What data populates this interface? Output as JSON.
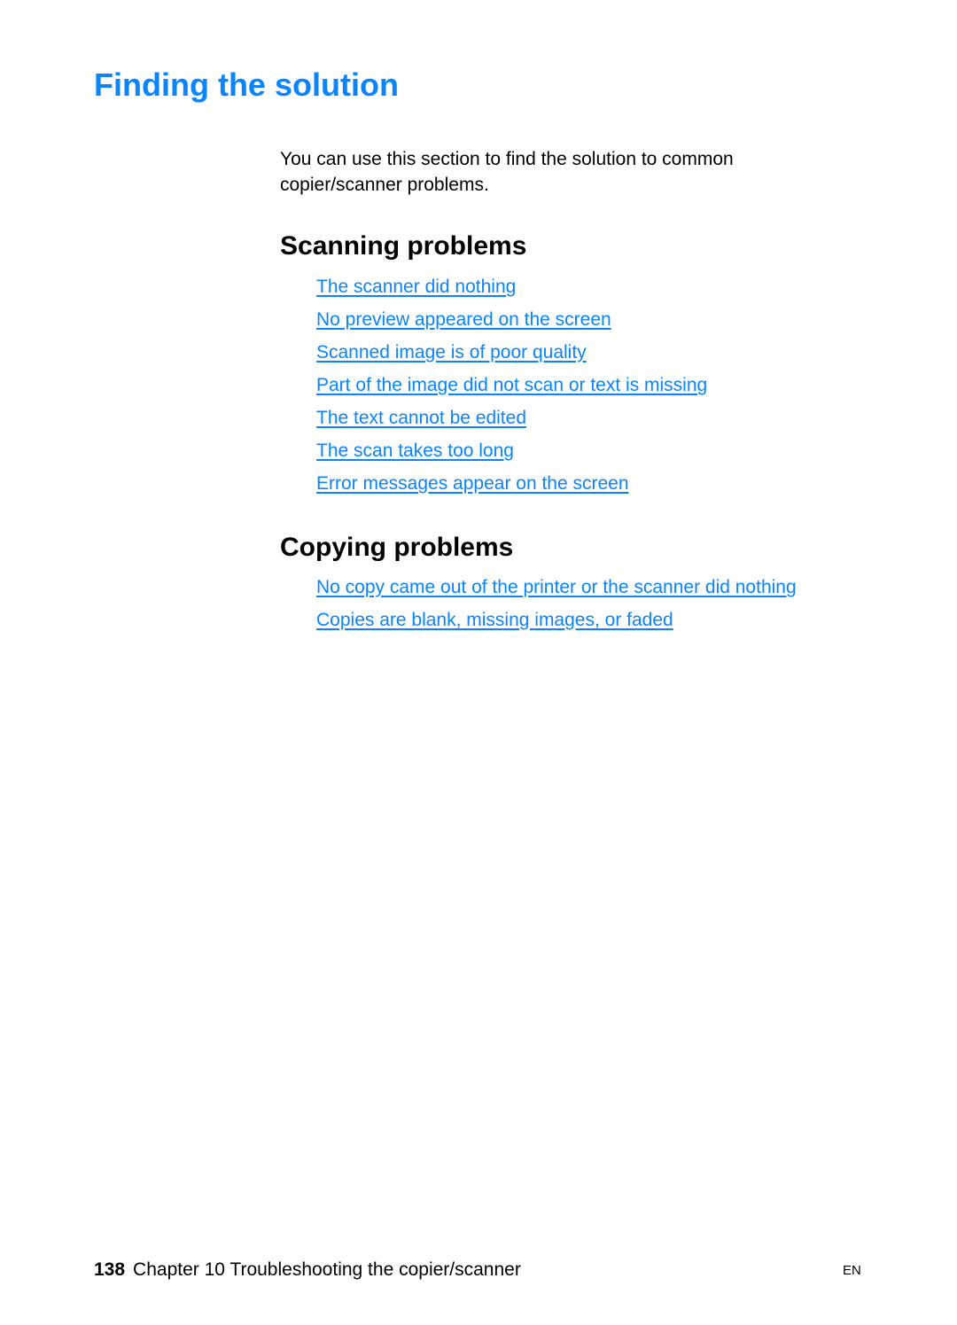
{
  "page": {
    "title": "Finding the solution",
    "intro": "You can use this section to find the solution to common copier/scanner problems."
  },
  "sections": [
    {
      "heading": "Scanning problems",
      "links": [
        "The scanner did nothing",
        "No preview appeared on the screen",
        "Scanned image is of poor quality",
        "Part of the image did not scan or text is missing",
        "The text cannot be edited",
        "The scan takes too long",
        "Error messages appear on the screen"
      ]
    },
    {
      "heading": "Copying problems",
      "links": [
        "No copy came out of the printer or the scanner did nothing",
        "Copies are blank, missing images, or faded"
      ]
    }
  ],
  "footer": {
    "page_number": "138",
    "chapter": "Chapter 10 Troubleshooting the copier/scanner",
    "language": "EN"
  },
  "colors": {
    "title": "#0a84ff",
    "link": "#0a84ff",
    "text": "#000000"
  }
}
